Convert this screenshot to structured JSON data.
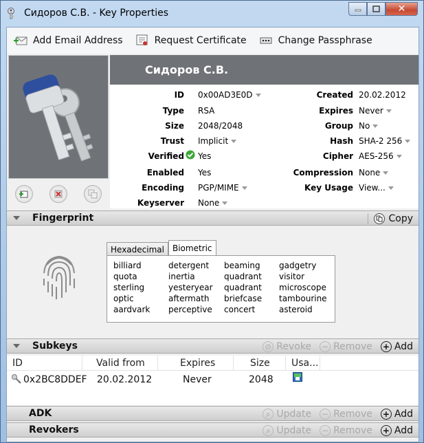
{
  "window": {
    "title": "Сидоров С.В. - Key Properties",
    "close_label": "✕"
  },
  "toolbar": {
    "add_email_label": "Add Email Address",
    "request_cert_label": "Request Certificate",
    "change_pass_label": "Change Passphrase"
  },
  "key": {
    "name": "Сидоров С.В.",
    "left": [
      {
        "label": "ID",
        "value": "0x00AD3E0D",
        "dropdown": true
      },
      {
        "label": "Type",
        "value": "RSA",
        "dropdown": false
      },
      {
        "label": "Size",
        "value": "2048/2048",
        "dropdown": false
      },
      {
        "label": "Trust",
        "value": "Implicit",
        "dropdown": true
      },
      {
        "label": "Verified",
        "value": "Yes",
        "dropdown": false
      },
      {
        "label": "Enabled",
        "value": "Yes",
        "dropdown": false
      },
      {
        "label": "Encoding",
        "value": "PGP/MIME",
        "dropdown": true
      },
      {
        "label": "Keyserver",
        "value": "None",
        "dropdown": true
      }
    ],
    "right": [
      {
        "label": "Created",
        "value": "20.02.2012",
        "dropdown": false
      },
      {
        "label": "Expires",
        "value": "Never",
        "dropdown": true
      },
      {
        "label": "Group",
        "value": "No",
        "dropdown": true
      },
      {
        "label": "Hash",
        "value": "SHA-2 256",
        "dropdown": true
      },
      {
        "label": "Cipher",
        "value": "AES-256",
        "dropdown": true
      },
      {
        "label": "Compression",
        "value": "None",
        "dropdown": true
      },
      {
        "label": "Key Usage",
        "value": "View...",
        "dropdown": true
      }
    ]
  },
  "fingerprint": {
    "title": "Fingerprint",
    "copy_label": "Copy",
    "tabs": [
      "Hexadecimal",
      "Biometric"
    ],
    "active_tab": "Biometric",
    "words": [
      "billiard",
      "detergent",
      "beaming",
      "gadgetry",
      "quota",
      "inertia",
      "quadrant",
      "visitor",
      "sterling",
      "yesteryear",
      "quadrant",
      "microscope",
      "optic",
      "aftermath",
      "briefcase",
      "tambourine",
      "aardvark",
      "perceptive",
      "concert",
      "asteroid"
    ]
  },
  "subkeys": {
    "title": "Subkeys",
    "revoke_label": "Revoke",
    "remove_label": "Remove",
    "add_label": "Add",
    "columns": [
      "ID",
      "Valid from",
      "Expires",
      "Size",
      "Usa..."
    ],
    "rows": [
      {
        "id": "0x2BC8DDEF",
        "valid_from": "20.02.2012",
        "expires": "Never",
        "size": "2048"
      }
    ]
  },
  "adk": {
    "title": "ADK",
    "update_label": "Update",
    "remove_label": "Remove",
    "add_label": "Add"
  },
  "revokers": {
    "title": "Revokers",
    "update_label": "Update",
    "remove_label": "Remove",
    "add_label": "Add"
  },
  "colors": {
    "banner": "#6f7378",
    "key_blue": "#2e4f9e",
    "verified_green": "#3aa635"
  }
}
